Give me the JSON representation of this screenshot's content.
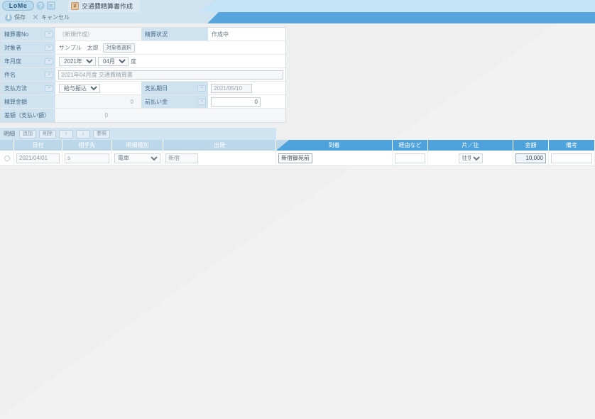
{
  "titlebar": {
    "logo_text": "LoMe",
    "help_icon": "?",
    "restore_icon": "❐",
    "tab_icon": "¥",
    "tab_label": "交通費精算書作成"
  },
  "toolbar": {
    "save_icon": "⬇",
    "save_label": "保存",
    "cancel_icon": "✕",
    "cancel_label": "キャンセル"
  },
  "form": {
    "badge_icon": "▫▫",
    "seisansho_no_label": "精算書No",
    "seisansho_no_value": "（新規作成）",
    "status_label": "精算状況",
    "status_value": "作成中",
    "taishosha_label": "対象者",
    "taishosha_value": "サンプル　太郎",
    "taishosha_button": "対象者選択",
    "nengetsudo_label": "年月度",
    "year_value": "2021年",
    "month_value": "04月",
    "do_suffix": "度",
    "kenmei_label": "件名",
    "kenmei_value": "2021年04月度 交通費精算書",
    "shiharai_hoho_label": "支払方法",
    "shiharai_hoho_value": "給与振込",
    "shiharai_kijitsu_label": "支払期日",
    "shiharai_kijitsu_value": "2021/05/10",
    "seisan_kingaku_label": "精算金額",
    "seisan_kingaku_value": "0",
    "maebaraikin_label": "前払い金",
    "maebaraikin_value": "0",
    "sagaku_label": "差額（支払い額）",
    "sagaku_value": "0"
  },
  "detail": {
    "toolbar_label": "明細",
    "add_button": "追加",
    "delete_button": "削除",
    "up_button": "↑",
    "down_button": "↓",
    "reference_button": "参照",
    "columns": [
      "日付",
      "相手先",
      "明細種別",
      "出発",
      "到着",
      "経由など",
      "片／往",
      "金額",
      "備考"
    ],
    "rows": [
      {
        "date": "2021/04/01",
        "partner": "s",
        "kind": "電車",
        "departure": "新宿",
        "arrival": "新宿御苑前",
        "via": "",
        "trip": "往復",
        "amount": "10,000",
        "note": ""
      }
    ]
  },
  "colors": {
    "accent_blue": "#4fa3dc",
    "label_blue": "#cfe2f0",
    "header_blue": "#bdd7ea",
    "page_bg": "#f2f2f2"
  }
}
